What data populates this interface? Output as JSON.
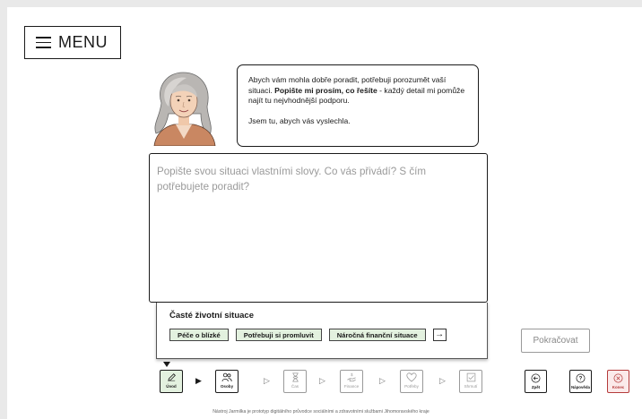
{
  "menu": {
    "label": "MENU"
  },
  "assistant": {
    "intro": "Abych vám mohla dobře poradit, potřebuji porozumět vaší situaci. ",
    "intro_bold": "Popište mi prosím, co řešíte",
    "intro_rest": " - každý detail mi pomůže najít tu nejvhodnější podporu.",
    "closing": "Jsem tu, abych vás vyslechla."
  },
  "input": {
    "placeholder": "Popište svou situaci vlastními slovy. Co vás přivádí? S čím potřebujete poradit?"
  },
  "situations": {
    "title": "Časté životní situace",
    "chips": [
      "Péče o blízké",
      "Potřebuji si promluvit",
      "Náročná finanční situace"
    ]
  },
  "continue_label": "Pokračovat",
  "steps": [
    {
      "label": "Úvod",
      "icon": "pencil-icon"
    },
    {
      "label": "Osoby",
      "icon": "people-icon"
    },
    {
      "label": "Čas",
      "icon": "hourglass-icon"
    },
    {
      "label": "Finance",
      "icon": "money-hand-icon"
    },
    {
      "label": "Potřeby",
      "icon": "heart-icon"
    },
    {
      "label": "Shrnutí",
      "icon": "checkbox-icon"
    }
  ],
  "tools": {
    "back": "Zpět",
    "help": "Nápověda",
    "end": "Konec"
  },
  "footer": "Nástroj Jarmilka je prototyp digitálního průvodce sociálními a zdravotními službami Jihomoravského kraje",
  "colors": {
    "chip_bg": "#e3f1df",
    "end_accent": "#b53b3b"
  }
}
